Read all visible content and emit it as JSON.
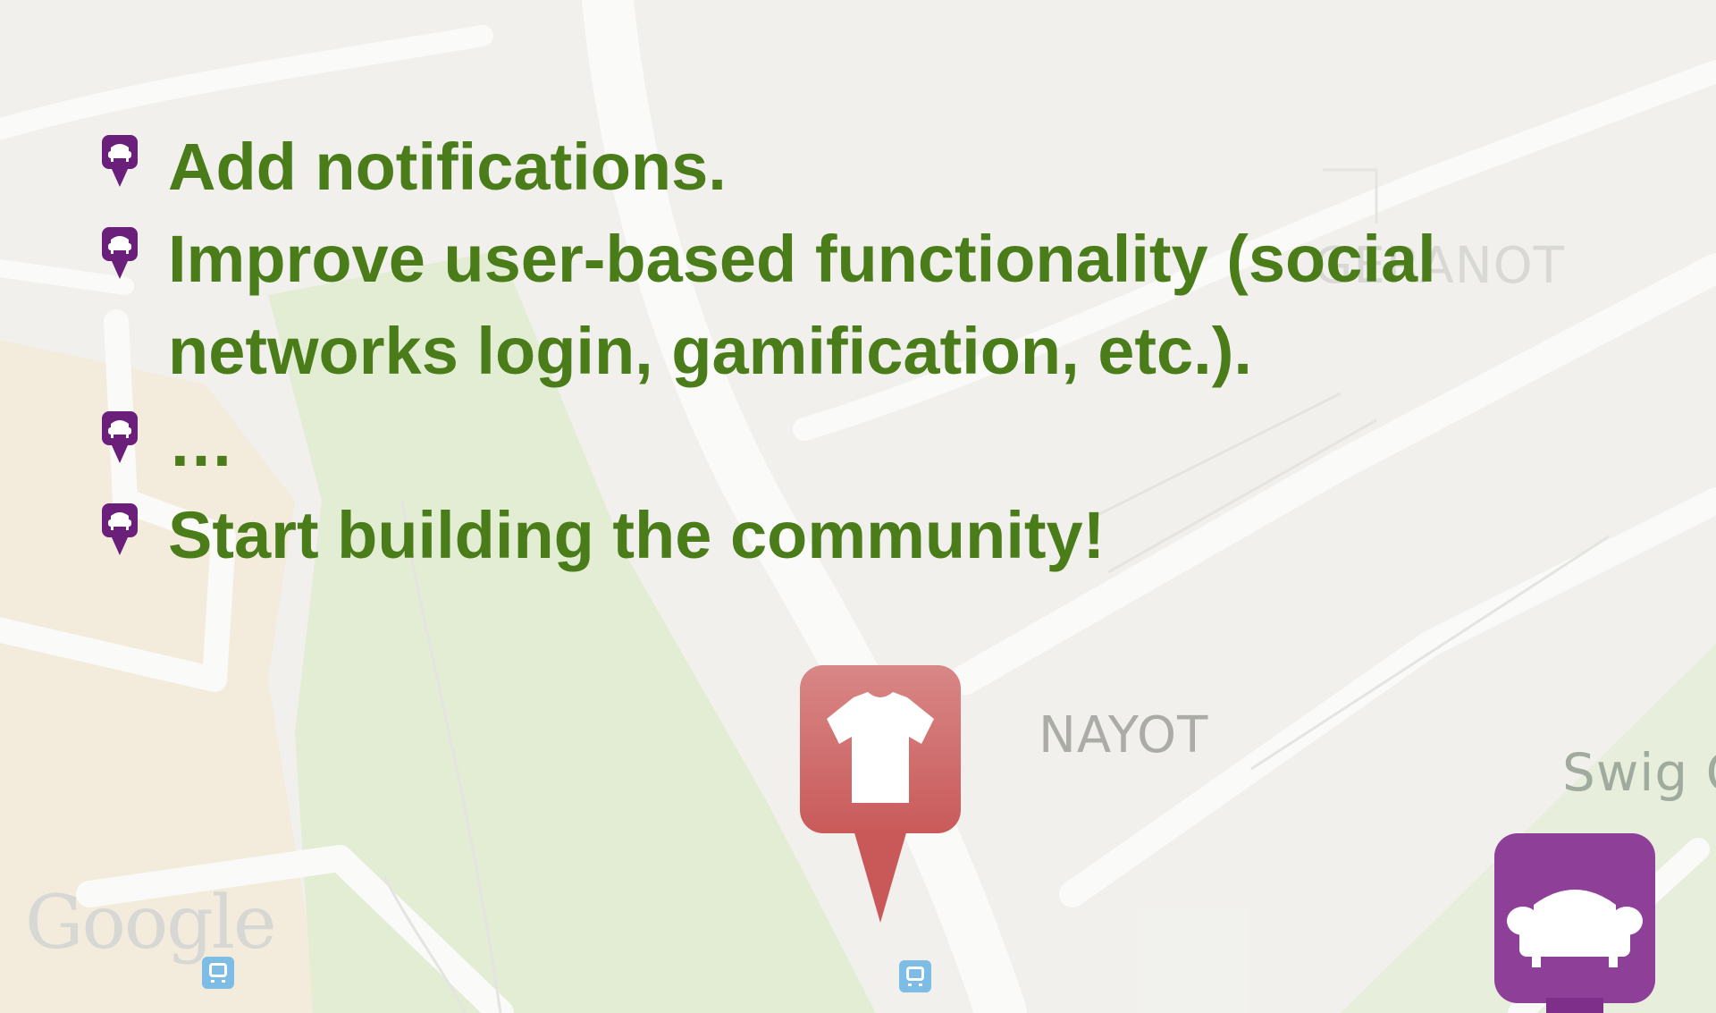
{
  "slide": {
    "bullets": [
      {
        "text": "Add notifications."
      },
      {
        "text": "Improve user-based functionality (social networks login, gamification, etc.)."
      },
      {
        "text": "…"
      },
      {
        "text": "Start building the community!"
      }
    ]
  },
  "map": {
    "labels": {
      "nayot": "NAYOT",
      "neve": "GERANOT",
      "swig": "Swig G"
    },
    "attribution": "Google"
  },
  "colors": {
    "bullet_text": "#4a7d1a",
    "bullet_icon": "#6a1f7a",
    "shirt_marker": "#cf6a6a",
    "sofa_marker": "#8e3f98",
    "park_green": "#d9e6c4"
  },
  "icons": {
    "bullet": "sofa-pin-icon",
    "shirt_marker": "shirt-marker-icon",
    "sofa_marker": "sofa-marker-icon",
    "bus": "bus-stop-icon"
  }
}
